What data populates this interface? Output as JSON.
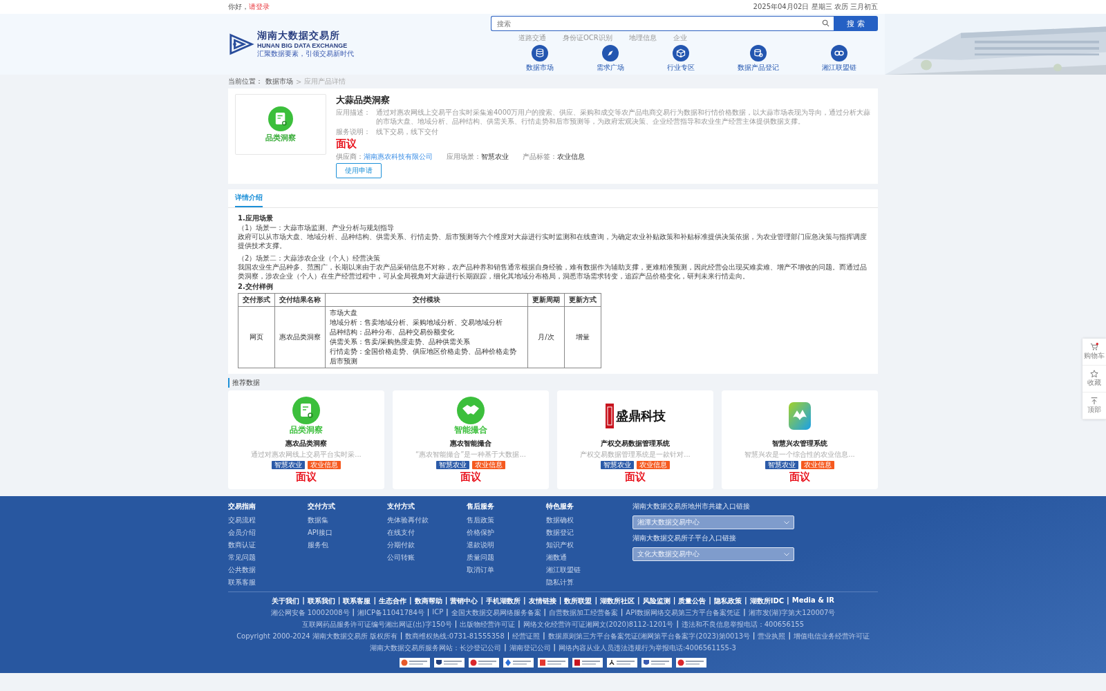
{
  "top_bar": {
    "greeting": "你好，",
    "login_link": "请登录",
    "date": "2025年04月02日 星期三 农历 三月初五"
  },
  "header": {
    "logo": {
      "name": "湖南大数据交易所",
      "english": "HUNAN BIG DATA EXCHANGE",
      "slogan": "汇聚数据要素，引领交易新时代"
    },
    "search": {
      "placeholder": "搜索",
      "button": "搜 索"
    },
    "hot_words": [
      "道路交通",
      "身份证OCR识别",
      "地理信息",
      "企业"
    ],
    "nav": [
      {
        "label": "数据市场",
        "kind": "database"
      },
      {
        "label": "需求广场",
        "kind": "compass"
      },
      {
        "label": "行业专区",
        "kind": "cube"
      },
      {
        "label": "数据产品登记",
        "kind": "register"
      },
      {
        "label": "湘江联盟链",
        "kind": "chain"
      }
    ]
  },
  "breadcrumb": {
    "label": "当前位置：",
    "items": [
      "数据市场",
      "应用产品详情"
    ],
    "separator": ">"
  },
  "product": {
    "image_caption": "品类洞察",
    "title": "大蒜品类洞察",
    "fields": [
      {
        "label": "应用描述：",
        "value": "通过对惠农网线上交易平台实时采集逾4000万用户的搜索、供应、采购和成交等农产品电商交易行为数据和行情价格数据，以大蒜市场表现为导向，通过分析大蒜的市场大盘、地域分析、品种结构、供需关系、行情走势和后市预测等，为政府宏观决策、企业经营指导和农业生产经营主体提供数据支撑。"
      },
      {
        "label": "服务说明：",
        "value": "线下交易，线下交付"
      }
    ],
    "price": "面议",
    "meta": [
      {
        "label": "供应商：",
        "value": "湖南惠农科技有限公司",
        "kind": "link"
      },
      {
        "label": "应用场景：",
        "value": "智慧农业",
        "kind": "text"
      },
      {
        "label": "产品标签：",
        "value": "农业信息",
        "kind": "text"
      }
    ],
    "button": "使用申请"
  },
  "detail": {
    "tabs": [
      {
        "label": "详情介绍",
        "selected": true
      }
    ],
    "blocks": [
      {
        "kind": "heading",
        "text": "1.应用场景"
      },
      {
        "kind": "text",
        "text": "（1）场景一：大蒜市场监测、产业分析与规划指导"
      },
      {
        "kind": "text",
        "text": "政府可以从市场大盘、地域分析、品种结构、供需关系、行情走势、后市预测等六个维度对大蒜进行实时监测和在线查询，为确定农业补贴政策和补贴标准提供决策依据，为农业管理部门应急决策与指挥调度提供技术支撑。"
      },
      {
        "kind": "gap"
      },
      {
        "kind": "text",
        "text": "（2）场景二：大蒜涉农企业（个人）经营决策"
      },
      {
        "kind": "text",
        "text": "我国农业生产品种多、范围广，长期以来由于农产品采销信息不对称，农产品种养和销售通常根据自身经验，难有数据作为辅助支撑，更难精准预测，因此经营会出现买难卖难、增产不增收的问题。而通过品类洞察，涉农企业（个人）在生产经营过程中，可从全局视角对大蒜进行长期跟踪，细化其地域分布格局，洞悉市场需求转变，追踪产品价格变化，研判未来行情走向。"
      },
      {
        "kind": "heading",
        "text": "2.交付样例"
      }
    ],
    "table": {
      "columns": [
        "交付形式",
        "交付结果名称",
        "交付模块",
        "更新周期",
        "更新方式"
      ],
      "rows": [
        [
          "网页",
          "惠农品类洞察",
          [
            "市场大盘",
            "地域分析：售卖地域分析、采购地域分析、交易地域分析",
            "品种结构：品种分布、品种交易份额变化",
            "供需关系：售卖/采购热度走势、品种供需关系",
            "行情走势：全国价格走势、供应地区价格走势、品种价格走势",
            "后市预测"
          ],
          "月/次",
          "增量"
        ]
      ]
    }
  },
  "recommend": {
    "title": "推荐数据",
    "items": [
      {
        "kind": "insight",
        "caption": "品类洞察",
        "name": "惠农品类洞察",
        "summary": "通过对惠农网线上交易平台实时采...",
        "tags": [
          {
            "label": "智慧农业",
            "color": "#2b5aa8"
          },
          {
            "label": "农业信息",
            "color": "#f5591f"
          }
        ],
        "price": "面议"
      },
      {
        "kind": "handshake",
        "caption": "智能撮合",
        "name": "惠农智能撮合",
        "summary": "“惠农智能撮合”是一种基于大数据...",
        "tags": [
          {
            "label": "智慧农业",
            "color": "#2b5aa8"
          },
          {
            "label": "农业信息",
            "color": "#f5591f"
          }
        ],
        "price": "面议"
      },
      {
        "kind": "logo",
        "caption": "盛鼎科技",
        "name": "产权交易数据管理系统",
        "summary": "产权交易数据管理系统是一款针对...",
        "tags": [
          {
            "label": "智慧农业",
            "color": "#2b5aa8"
          },
          {
            "label": "农业信息",
            "color": "#f5591f"
          }
        ],
        "price": "面议"
      },
      {
        "kind": "app",
        "name": "智慧兴农管理系统",
        "summary": "智慧兴农是一个综合性的农业信息...",
        "tags": [
          {
            "label": "智慧农业",
            "color": "#2b5aa8"
          },
          {
            "label": "农业信息",
            "color": "#f5591f"
          }
        ],
        "price": "面议"
      }
    ]
  },
  "side_bar": [
    {
      "label": "购物车",
      "kind": "cart"
    },
    {
      "label": "收藏",
      "kind": "star"
    },
    {
      "label": "顶部",
      "kind": "top"
    }
  ],
  "footer": {
    "columns": [
      {
        "title": "交易指南",
        "links": [
          "交易流程",
          "会员介绍",
          "数商认证",
          "常见问题",
          "公共数据",
          "联系客服"
        ]
      },
      {
        "title": "交付方式",
        "links": [
          "数据集",
          "API接口",
          "服务包"
        ]
      },
      {
        "title": "支付方式",
        "links": [
          "先体验再付款",
          "在线支付",
          "分期付款",
          "公司转账"
        ]
      },
      {
        "title": "售后服务",
        "links": [
          "售后政策",
          "价格保护",
          "退款说明",
          "质量问题",
          "取消订单"
        ]
      },
      {
        "title": "特色服务",
        "links": [
          "数据确权",
          "数据登记",
          "知识产权",
          "湘数通",
          "湘江联盟链",
          "隐私计算"
        ]
      }
    ],
    "portals": [
      {
        "title": "湖南大数据交易所地州市共建入口链接",
        "value": "湘潭大数据交易中心"
      },
      {
        "title": "湖南大数据交易所子平台入口链接",
        "value": "文化大数据交易中心"
      }
    ],
    "links": [
      "关于我们",
      "联系我们",
      "联系客服",
      "生态合作",
      "数商帮助",
      "营销中心",
      "手机湖数所",
      "友情链接",
      "数所联盟",
      "湖数所社区",
      "风险监测",
      "质量公告",
      "隐私政策",
      "湖数所IDC",
      "Media & IR"
    ],
    "legal": [
      [
        "湘公网安备 10002008号",
        "湘ICP备11041784号",
        "ICP",
        "全国大数据交易网络服务备案",
        "自营数据加工经营备案",
        "API数据网络交易第三方平台备案凭证",
        "湘市发(湖)字第大120007号"
      ],
      [
        "互联网药品服务许可证编号湘出网证(出)字150号",
        "出版物经营许可证",
        "网络文化经营许可证湘网文(2020)8112-1201号",
        "违法和不良信息举报电话：400656155"
      ],
      [
        "Copyright 2000-2024 湖南大数据交易所 版权所有",
        "数商维权热线:0731-81555358",
        "经营证照",
        "数据原则第三方平台备案凭证(湘网第平台备案字(2023)第0013号",
        "营业执照",
        "增值电信业务经营许可证"
      ],
      [
        "湖南大数据交易所服务网站：长沙登记公司",
        "湖南登记公司",
        "网络内容从业人员违法违规行为举报电话:4006561155-3"
      ]
    ],
    "separator": "|",
    "badges": [
      {
        "kind": "emblem"
      },
      {
        "kind": "police"
      },
      {
        "kind": "red"
      },
      {
        "kind": "diamond"
      },
      {
        "kind": "download"
      },
      {
        "kind": "stamp"
      },
      {
        "kind": "accessible"
      },
      {
        "kind": "shield"
      },
      {
        "kind": "flag"
      }
    ]
  }
}
